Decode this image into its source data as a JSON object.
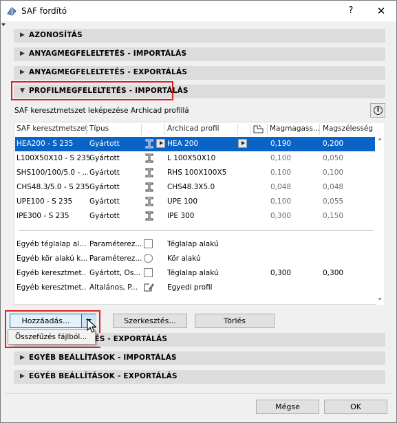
{
  "window": {
    "title": "SAF fordító",
    "help_label": "?",
    "close_label": "✕"
  },
  "sections_top": [
    {
      "label": "AZONOSÍTÁS",
      "state": "collapsed"
    },
    {
      "label": "ANYAGMEGFELELTETÉS - IMPORTÁLÁS",
      "state": "collapsed"
    },
    {
      "label": "ANYAGMEGFELELTETÉS - EXPORTÁLÁS",
      "state": "collapsed"
    },
    {
      "label": "PROFILMEGFELELTETÉS - IMPORTÁLÁS",
      "state": "expanded"
    }
  ],
  "panel": {
    "caption": "SAF keresztmetszet leképezése Archicad profillá",
    "info_label": "i",
    "columns": {
      "saf": "SAF keresztmetszet",
      "type": "Típus",
      "archicad": "Archicad profil",
      "height": "Magmagass...",
      "width": "Magszélesség"
    },
    "rows": [
      {
        "saf": "HEA200 - S 235",
        "type": "Gyártott",
        "profile": "HEA 200",
        "height": "0,190",
        "width": "0,200",
        "selected": true
      },
      {
        "saf": "L100X50X10 - S 235",
        "type": "Gyártott",
        "profile": "L 100X50X10",
        "height": "0,100",
        "width": "0,050"
      },
      {
        "saf": "SHS100/100/5.0 - ...",
        "type": "Gyártott",
        "profile": "RHS 100X100X5",
        "height": "0,100",
        "width": "0,100"
      },
      {
        "saf": "CHS48.3/5.0 - S 235",
        "type": "Gyártott",
        "profile": "CHS48.3X5.0",
        "height": "0,048",
        "width": "0,048"
      },
      {
        "saf": "UPE100 - S 235",
        "type": "Gyártott",
        "profile": "UPE 100",
        "height": "0,100",
        "width": "0,055"
      },
      {
        "saf": "IPE300 - S 235",
        "type": "Gyártott",
        "profile": "IPE 300",
        "height": "0,300",
        "width": "0,150"
      }
    ],
    "other_rows": [
      {
        "saf": "Egyéb téglalap al...",
        "type": "Paraméterez...",
        "profile": "Téglalap alakú",
        "height": "",
        "width": ""
      },
      {
        "saf": "Egyéb kör alakú k...",
        "type": "Paraméterez...",
        "profile": "Kör alakú",
        "height": "",
        "width": ""
      },
      {
        "saf": "Egyéb keresztmet...",
        "type": "Gyártott, Ös...",
        "profile": "Téglalap alakú",
        "height": "0,300",
        "width": "0,300"
      },
      {
        "saf": "Egyéb keresztmet...",
        "type": "Általános, P...",
        "profile": "Egyedi profil",
        "height": "",
        "width": ""
      }
    ],
    "buttons": {
      "add": "Hozzáadás...",
      "edit": "Szerkesztés...",
      "delete": "Törlés"
    },
    "add_menu": {
      "item": "Összefűzés fájlból..."
    }
  },
  "sections_bottom": [
    {
      "label": "PROFILMEGFELELTETÉS - EXPORTÁLÁS",
      "visible_text": "TÉS - EXPORTÁLÁS",
      "state": "collapsed"
    },
    {
      "label": "EGYÉB BEÁLLÍTÁSOK - IMPORTÁLÁS",
      "state": "collapsed"
    },
    {
      "label": "EGYÉB BEÁLLÍTÁSOK - EXPORTÁLÁS",
      "state": "collapsed"
    }
  ],
  "footer": {
    "cancel": "Mégse",
    "ok": "OK"
  },
  "colors": {
    "selection": "#0a64c8",
    "highlight": "#e0201b",
    "section_bg": "#dcdcdc"
  }
}
